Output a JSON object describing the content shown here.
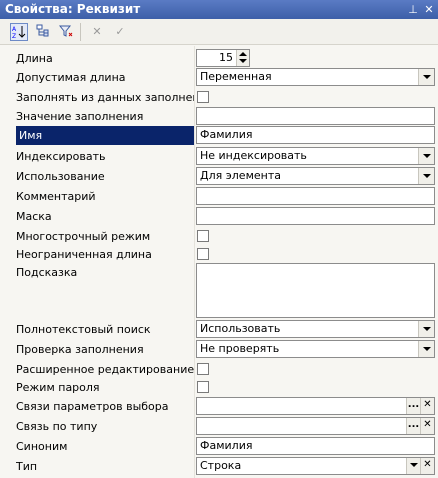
{
  "window": {
    "title": "Свойства: Реквизит",
    "pin_icon": "pin-icon",
    "close_icon": "close-icon"
  },
  "toolbar": {
    "buttons": [
      "sort-alpha-icon",
      "categories-icon",
      "filter-icon",
      "delete-icon",
      "apply-icon"
    ]
  },
  "properties": {
    "length": {
      "label": "Длина",
      "value": "15"
    },
    "allowed_length": {
      "label": "Допустимая длина",
      "value": "Переменная"
    },
    "fill_from_data": {
      "label": "Заполнять из данных заполнения"
    },
    "fill_value": {
      "label": "Значение заполнения",
      "value": ""
    },
    "name": {
      "label": "Имя",
      "value": "Фамилия"
    },
    "indexing": {
      "label": "Индексировать",
      "value": "Не индексировать"
    },
    "usage": {
      "label": "Использование",
      "value": "Для элемента"
    },
    "comment": {
      "label": "Комментарий",
      "value": ""
    },
    "mask": {
      "label": "Маска",
      "value": ""
    },
    "multiline": {
      "label": "Многострочный режим"
    },
    "unlimited_length": {
      "label": "Неограниченная длина"
    },
    "hint": {
      "label": "Подсказка",
      "value": ""
    },
    "fulltext_search": {
      "label": "Полнотекстовый поиск",
      "value": "Использовать"
    },
    "fill_check": {
      "label": "Проверка заполнения",
      "value": "Не проверять"
    },
    "extended_edit": {
      "label": "Расширенное редактирование"
    },
    "password_mode": {
      "label": "Режим пароля"
    },
    "choice_params": {
      "label": "Связи параметров выбора",
      "value": ""
    },
    "type_link": {
      "label": "Связь по типу",
      "value": ""
    },
    "synonym": {
      "label": "Синоним",
      "value": "Фамилия"
    },
    "type": {
      "label": "Тип",
      "value": "Строка"
    }
  },
  "glyphs": {
    "ellipsis": "...",
    "clear": "✕"
  }
}
